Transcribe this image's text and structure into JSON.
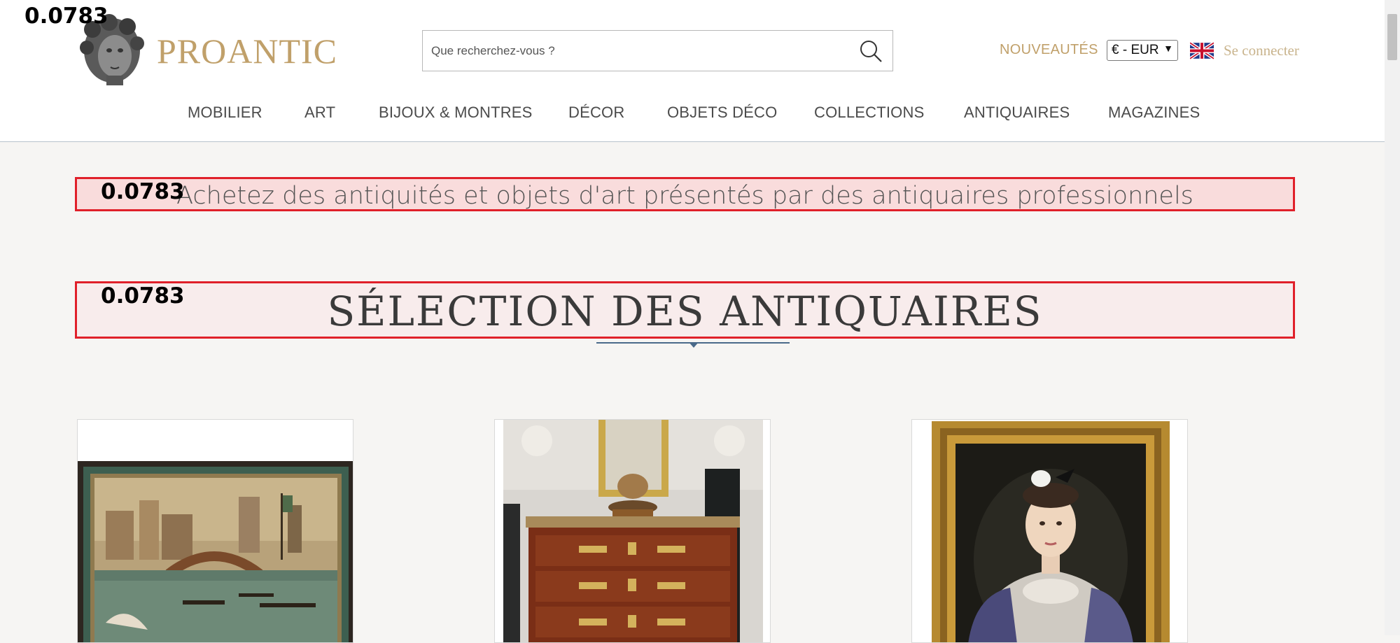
{
  "overlay": {
    "score": "0.0783"
  },
  "header": {
    "brand": "PROANTIC",
    "search": {
      "placeholder": "Que recherchez-vous ?",
      "value": ""
    },
    "nouveautes": "NOUVEAUTÉS",
    "currency": "€ - EUR",
    "login": "Se connecter",
    "nav": [
      "MOBILIER",
      "ART",
      "BIJOUX & MONTRES",
      "DÉCOR",
      "OBJETS DÉCO",
      "COLLECTIONS",
      "ANTIQUAIRES",
      "MAGAZINES"
    ]
  },
  "main": {
    "tagline": "Achetez des antiquités et objets d'art présentés par des antiquaires professionnels",
    "section_title": "SÉLECTION DES ANTIQUAIRES",
    "cards": [
      {
        "image": "venetian-canal-painting"
      },
      {
        "image": "louis-xv-commode"
      },
      {
        "image": "portrait-painting-gilt-frame"
      }
    ]
  },
  "colors": {
    "brand_gold": "#c0a06a",
    "highlight_red": "#e0202a",
    "background": "#f6f5f3"
  }
}
